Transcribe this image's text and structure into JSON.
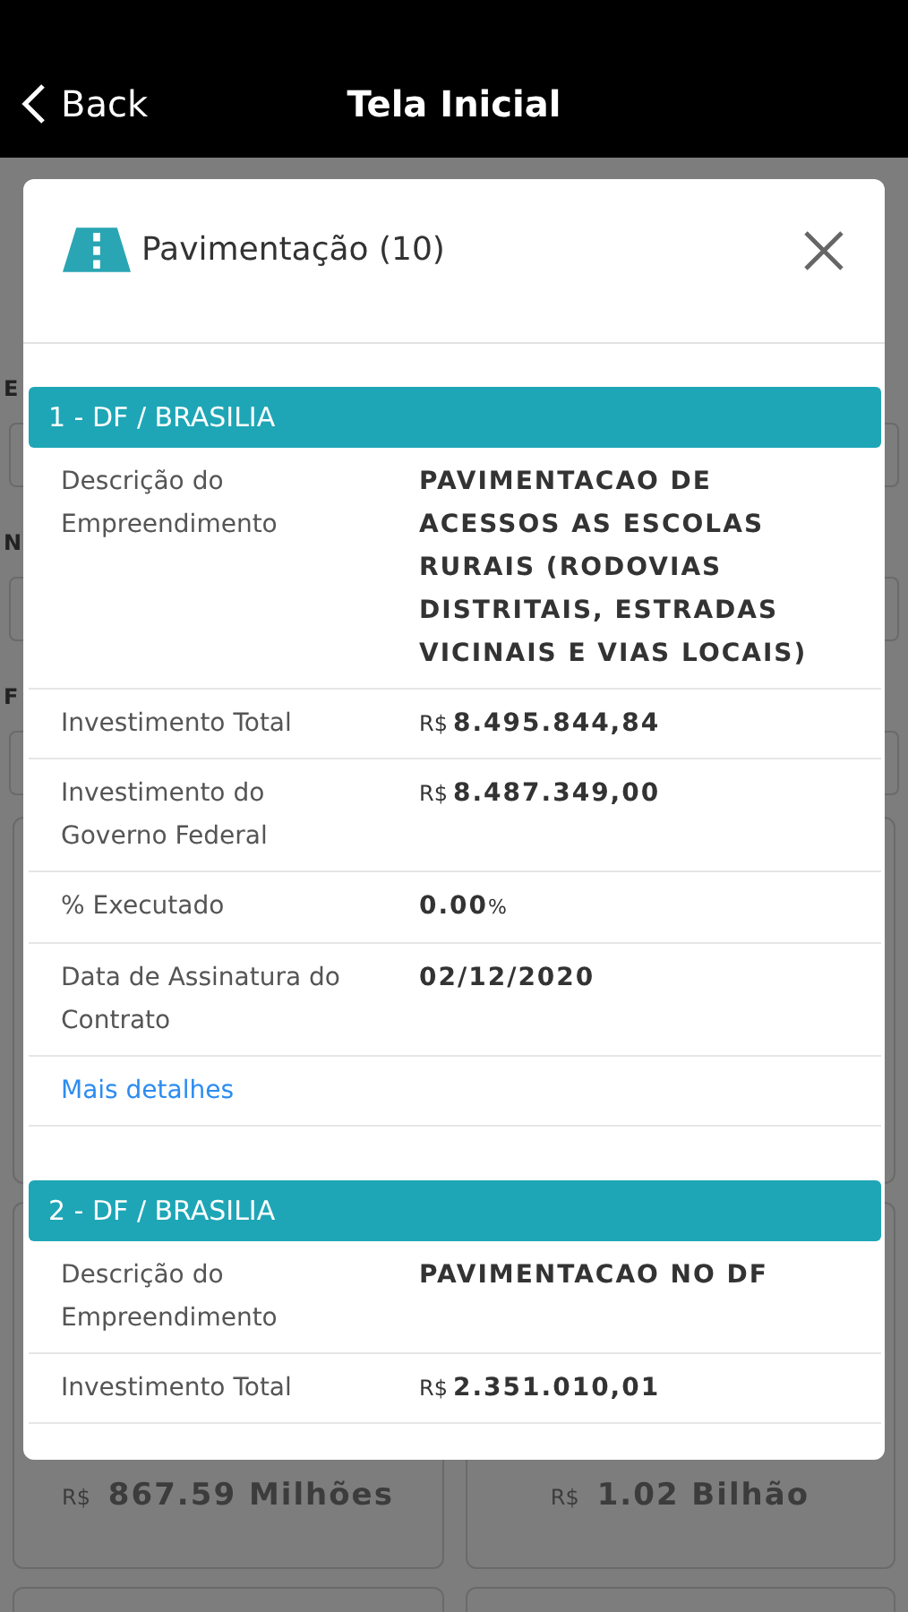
{
  "nav_bar": {
    "back": "Back",
    "title": "Tela Inicial"
  },
  "background": {
    "labels": [
      "E",
      "N",
      "F"
    ],
    "cards": [
      {
        "currency": "R$",
        "value": "867.59 Milhões"
      },
      {
        "currency": "R$",
        "value": "1.02 Bilhão"
      }
    ]
  },
  "modal": {
    "title": "Pavimentação (10)",
    "groups": [
      {
        "header": "1 - DF / BRASILIA",
        "link": "Mais detalhes",
        "rows": [
          {
            "label": "Descrição do Empreendimento",
            "value": "PAVIMENTACAO DE ACESSOS AS ESCOLAS RURAIS (RODOVIAS DISTRITAIS, ESTRADAS VICINAIS E VIAS LOCAIS)"
          },
          {
            "label": "Investimento Total",
            "prefix": "R$",
            "value": "8.495.844,84"
          },
          {
            "label": "Investimento do Governo Federal",
            "prefix": "R$",
            "value": "8.487.349,00"
          },
          {
            "label": "% Executado",
            "value": "0.00",
            "suffix": "%"
          },
          {
            "label": "Data de Assinatura do Contrato",
            "value": "02/12/2020"
          }
        ]
      },
      {
        "header": "2 - DF / BRASILIA",
        "rows": [
          {
            "label": "Descrição do Empreendimento",
            "value": "PAVIMENTACAO NO DF"
          },
          {
            "label": "Investimento Total",
            "prefix": "R$",
            "value": "2.351.010,01"
          }
        ]
      }
    ]
  }
}
